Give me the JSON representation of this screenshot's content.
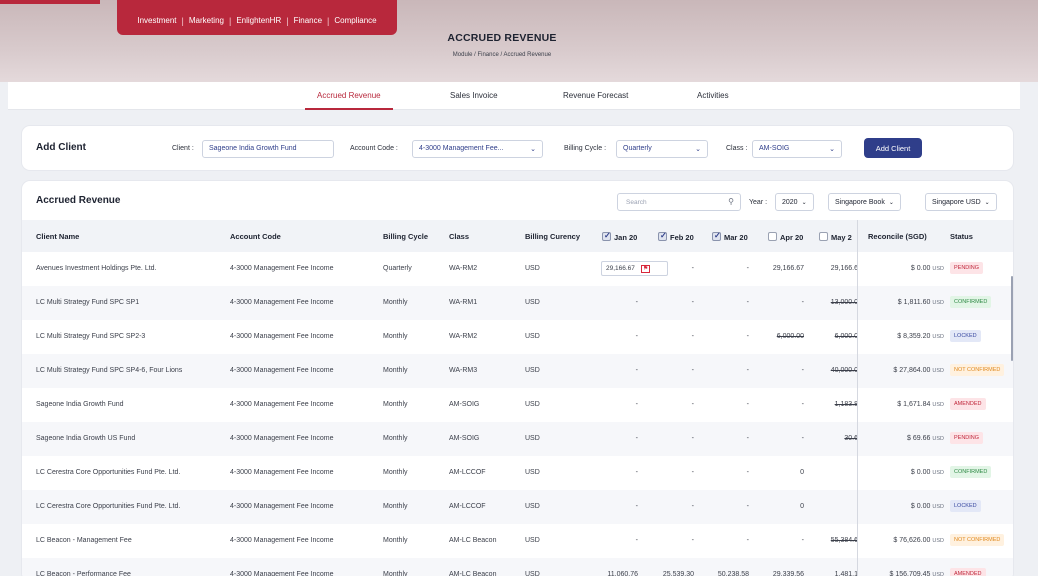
{
  "header": {
    "modules": [
      "Investment",
      "Marketing",
      "EnlightenHR",
      "Finance",
      "Compliance"
    ],
    "title": "ACCRUED REVENUE",
    "breadcrumb": "Module / Finance / Accrued Revenue"
  },
  "tabs": [
    "Accrued Revenue",
    "Sales Invoice",
    "Revenue Forecast",
    "Activities"
  ],
  "add_client": {
    "title": "Add Client",
    "client_label": "Client :",
    "client_value": "Sageone India Growth Fund",
    "account_label": "Account Code :",
    "account_value": "4-3000 Management Fee...",
    "cycle_label": "Billing Cycle :",
    "cycle_value": "Quarterly",
    "class_label": "Class :",
    "class_value": "AM-SOIG",
    "button": "Add Client"
  },
  "revenue": {
    "title": "Accrued Revenue",
    "search_placeholder": "Search",
    "year_label": "Year :",
    "year_value": "2020",
    "book_value": "Singapore Book",
    "currency_value": "Singapore USD",
    "headers": {
      "client": "Client Name",
      "account": "Account Code",
      "cycle": "Billing Cycle",
      "class": "Class",
      "currency": "Billing Curency",
      "jan": "Jan 20",
      "feb": "Feb 20",
      "mar": "Mar 20",
      "apr": "Apr 20",
      "may": "May 2",
      "reconcile": "Reconcile (SGD)",
      "status": "Status"
    },
    "rows": [
      {
        "client": "Avenues Investment Holdings Pte. Ltd.",
        "account": "4-3000 Management Fee Income",
        "cycle": "Quarterly",
        "cls": "WA-RM2",
        "cur": "USD",
        "jan": "29,166.67",
        "feb": "-",
        "mar": "-",
        "apr": "29,166.67",
        "may": "29,166.6",
        "rec": "$ 0.00",
        "rec_cur": "USD",
        "status": "PENDING"
      },
      {
        "client": "LC Multi Strategy Fund SPC SP1",
        "account": "4-3000 Management Fee Income",
        "cycle": "Monthly",
        "cls": "WA-RM1",
        "cur": "USD",
        "jan": "-",
        "feb": "-",
        "mar": "-",
        "apr": "-",
        "may": "13,000.0",
        "rec": "$ 1,811.60",
        "rec_cur": "USD",
        "status": "CONFIRMED"
      },
      {
        "client": "LC Multi Strategy Fund SPC SP2-3",
        "account": "4-3000 Management Fee Income",
        "cycle": "Monthly",
        "cls": "WA-RM2",
        "cur": "USD",
        "jan": "-",
        "feb": "-",
        "mar": "-",
        "apr": "6,000.00",
        "may": "6,000.0",
        "rec": "$ 8,359.20",
        "rec_cur": "USD",
        "status": "LOCKED"
      },
      {
        "client": "LC Multi Strategy Fund SPC SP4-6, Four Lions",
        "account": "4-3000 Management Fee Income",
        "cycle": "Monthly",
        "cls": "WA-RM3",
        "cur": "USD",
        "jan": "-",
        "feb": "-",
        "mar": "-",
        "apr": "-",
        "may": "40,000.0",
        "rec": "$ 27,864.00",
        "rec_cur": "USD",
        "status": "NOT CONFIRMED"
      },
      {
        "client": "Sageone India Growth Fund",
        "account": "4-3000 Management Fee Income",
        "cycle": "Monthly",
        "cls": "AM-SOIG",
        "cur": "USD",
        "jan": "-",
        "feb": "-",
        "mar": "-",
        "apr": "-",
        "may": "1,183.8",
        "rec": "$ 1,671.84",
        "rec_cur": "USD",
        "status": "AMENDED"
      },
      {
        "client": "Sageone India Growth US Fund",
        "account": "4-3000 Management Fee Income",
        "cycle": "Monthly",
        "cls": "AM-SOIG",
        "cur": "USD",
        "jan": "-",
        "feb": "-",
        "mar": "-",
        "apr": "-",
        "may": "30.6",
        "rec": "$ 69.66",
        "rec_cur": "USD",
        "status": "PENDING"
      },
      {
        "client": "LC Cerestra Core Opportunities Fund Pte. Ltd.",
        "account": "4-3000 Management Fee Income",
        "cycle": "Monthly",
        "cls": "AM-LCCOF",
        "cur": "USD",
        "jan": "-",
        "feb": "-",
        "mar": "-",
        "apr": "0",
        "may": "",
        "rec": "$ 0.00",
        "rec_cur": "USD",
        "status": "CONFIRMED"
      },
      {
        "client": "LC Cerestra Core Opportunities Fund Pte. Ltd.",
        "account": "4-3000 Management Fee Income",
        "cycle": "Monthly",
        "cls": "AM-LCCOF",
        "cur": "USD",
        "jan": "-",
        "feb": "-",
        "mar": "-",
        "apr": "0",
        "may": "",
        "rec": "$ 0.00",
        "rec_cur": "USD",
        "status": "LOCKED"
      },
      {
        "client": "LC Beacon - Management Fee",
        "account": "4-3000 Management Fee Income",
        "cycle": "Monthly",
        "cls": "AM-LC Beacon",
        "cur": "USD",
        "jan": "-",
        "feb": "-",
        "mar": "-",
        "apr": "-",
        "may": "55,384.6",
        "rec": "$ 76,626.00",
        "rec_cur": "USD",
        "status": "NOT CONFIRMED"
      },
      {
        "client": "LC Beacon - Performance Fee",
        "account": "4-3000 Management Fee Income",
        "cycle": "Monthly",
        "cls": "AM-LC Beacon",
        "cur": "USD",
        "jan": "11,060.76",
        "feb": "25,539.30",
        "mar": "50,238.58",
        "apr": "29,339.56",
        "may": "1,481.1",
        "rec": "$ 156,709.45",
        "rec_cur": "USD",
        "status": "AMENDED"
      }
    ]
  }
}
